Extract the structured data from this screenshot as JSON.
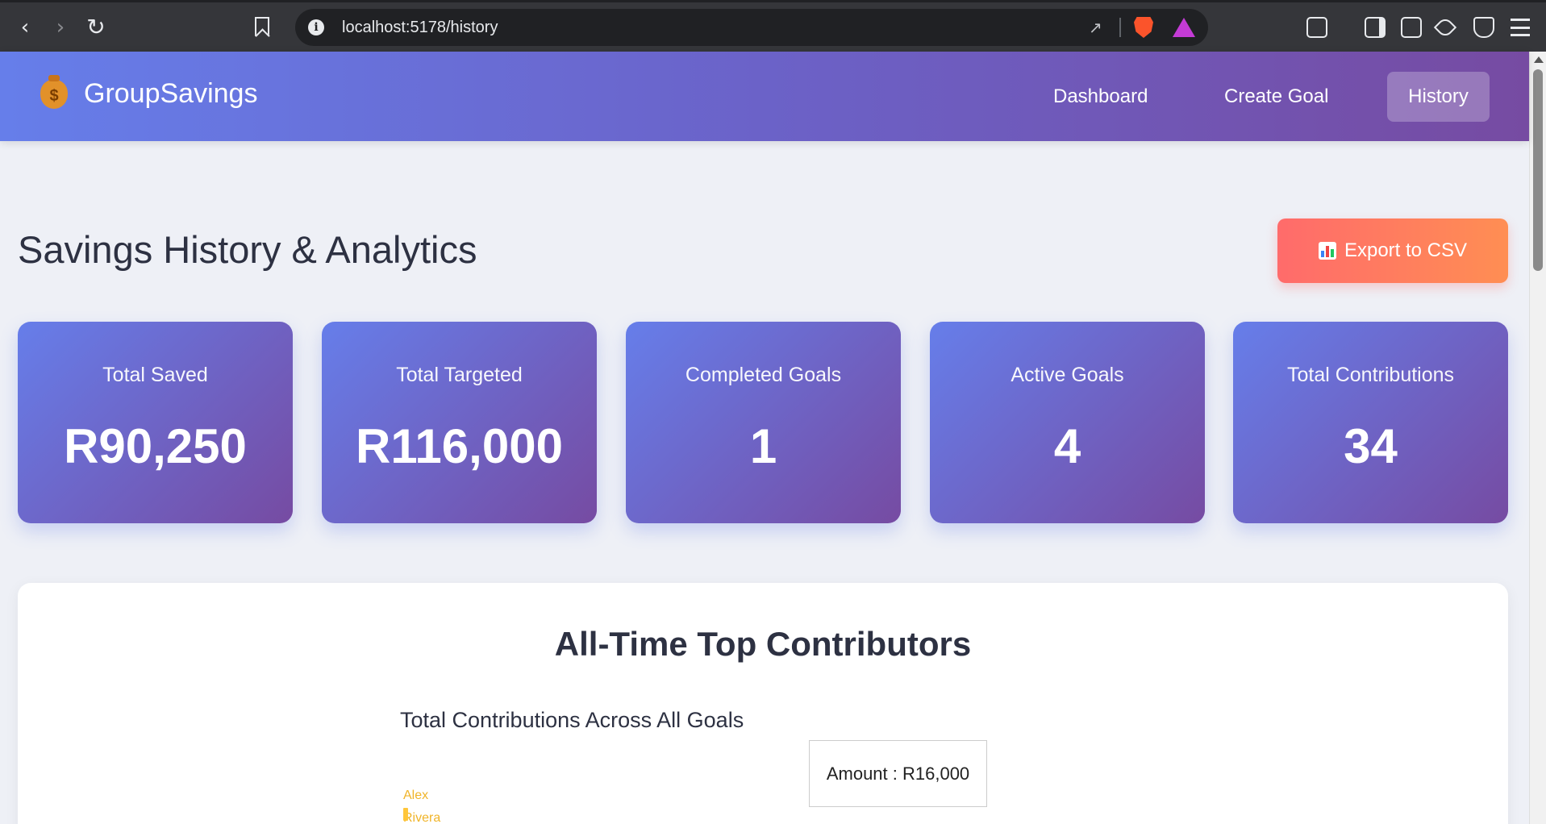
{
  "browser": {
    "url": "localhost:5178/history"
  },
  "header": {
    "brand_icon": "money-bag-icon",
    "brand": "GroupSavings",
    "nav": [
      {
        "label": "Dashboard",
        "active": false
      },
      {
        "label": "Create Goal",
        "active": false
      },
      {
        "label": "History",
        "active": true
      }
    ]
  },
  "page": {
    "title": "Savings History & Analytics",
    "export_icon": "bar-chart-icon",
    "export_label": "Export to CSV"
  },
  "stats": [
    {
      "label": "Total Saved",
      "value": "R90,250"
    },
    {
      "label": "Total Targeted",
      "value": "R116,000"
    },
    {
      "label": "Completed Goals",
      "value": "1"
    },
    {
      "label": "Active Goals",
      "value": "4"
    },
    {
      "label": "Total Contributions",
      "value": "34"
    }
  ],
  "contributors": {
    "title": "All-Time Top Contributors",
    "chart_title": "Total Contributions Across All Goals",
    "tooltip": "Amount : R16,000",
    "first_contributor": "Alex Rivera",
    "bar_color": "#ffc63a"
  },
  "colors": {
    "header_gradient": [
      "#667eea",
      "#764ba2"
    ],
    "export_gradient": [
      "#ff6b6b",
      "#ff8e53"
    ]
  }
}
